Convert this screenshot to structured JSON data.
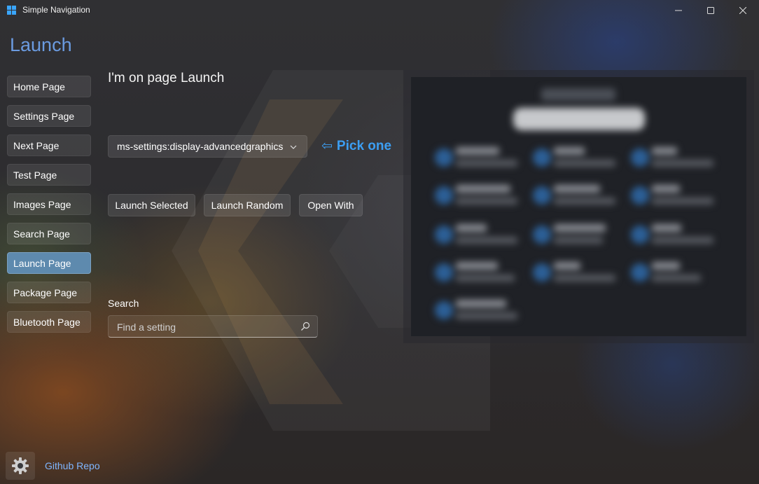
{
  "window": {
    "title": "Simple Navigation",
    "minimize_glyph": "—",
    "maximize_glyph": "☐",
    "close_glyph": "✕"
  },
  "header": {
    "title": "Launch"
  },
  "nav": {
    "items": [
      {
        "label": "Home Page",
        "selected": false
      },
      {
        "label": "Settings Page",
        "selected": false
      },
      {
        "label": "Next Page",
        "selected": false
      },
      {
        "label": "Test Page",
        "selected": false
      },
      {
        "label": "Images Page",
        "selected": false
      },
      {
        "label": "Search Page",
        "selected": false
      },
      {
        "label": "Launch Page",
        "selected": true
      },
      {
        "label": "Package Page",
        "selected": false
      },
      {
        "label": "Bluetooth Page",
        "selected": false
      }
    ]
  },
  "main": {
    "title": "I'm on page Launch",
    "combo": {
      "selected": "ms-settings:display-advancedgraphics",
      "chevron": "⌄"
    },
    "pick_hint": {
      "arrow": "⇦",
      "text": "Pick one"
    },
    "buttons": {
      "launch_selected": "Launch Selected",
      "launch_random": "Launch Random",
      "open_with": "Open With"
    },
    "search": {
      "label": "Search",
      "placeholder": "Find a setting",
      "value": ""
    }
  },
  "footer": {
    "link": "Github Repo",
    "icon": "gear-icon"
  },
  "colors": {
    "accent": "#6b9be0",
    "hint": "#3c9ef2",
    "nav_selected": "#5e8aae",
    "link": "#7fb6ff"
  }
}
